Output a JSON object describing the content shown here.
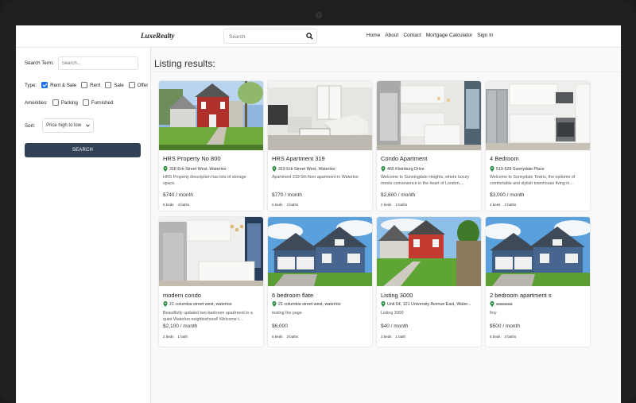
{
  "header": {
    "logo": "LuxeRealty",
    "search_placeholder": "Search",
    "links": [
      "Home",
      "About",
      "Contact",
      "Mortgage Calculator",
      "Sign In"
    ]
  },
  "sidebar": {
    "search_term_label": "Search Term:",
    "search_term_placeholder": "Search...",
    "type_label": "Type:",
    "types": [
      {
        "label": "Rent & Sale",
        "checked": true
      },
      {
        "label": "Rent",
        "checked": false
      },
      {
        "label": "Sale",
        "checked": false
      },
      {
        "label": "Offer",
        "checked": false
      }
    ],
    "amenities_label": "Amenities:",
    "amenities": [
      {
        "label": "Parking",
        "checked": false
      },
      {
        "label": "Furnished",
        "checked": false
      }
    ],
    "sort_label": "Sort:",
    "sort_value": "Price high to low",
    "search_button": "SEARCH"
  },
  "main": {
    "heading": "Listing results:",
    "listings": [
      {
        "title": "HRS Property No 800",
        "address": "318 Erb Street West, Waterloo",
        "description": "HRS Property description has lots of storage space.",
        "price": "$740 / month",
        "beds": "6 beds",
        "baths": "4 baths",
        "image": "red-brick-house"
      },
      {
        "title": "HRS Apartment 319",
        "address": "319 Erb Street West, Waterloo",
        "description": "Apartment 319 5th floor apartment in Waterloo",
        "price": "$770 / month",
        "beds": "5 beds",
        "baths": "2 baths",
        "image": "living-room"
      },
      {
        "title": "Condo Apartment",
        "address": "465 Kleinburg Drive",
        "description": "Welcome to Sunningdale Heights, where luxury meets convenience in the heart of London,...",
        "price": "$2,600 / month",
        "beds": "2 beds",
        "baths": "2 baths",
        "image": "modern-kitchen"
      },
      {
        "title": "4 Bedroom",
        "address": "519-529 Sunnydale Place",
        "description": "Welcome to Sunnydale Towns, the epitome of comfortable and stylish townhouse living in...",
        "price": "$3,000 / month",
        "beds": "4 beds",
        "baths": "2 baths",
        "image": "steel-kitchen"
      },
      {
        "title": "modern condo",
        "address": "21 columbia street west, waterloo",
        "description": "Beautifully updated two-bedroom apartment in a quiet Waterloo neighborhood! Welcome t...",
        "price": "$2,100 / month",
        "beds": "2 beds",
        "baths": "1 bath",
        "image": "condo-kitchen"
      },
      {
        "title": "6 bedroom flate",
        "address": "21 columbia street west, waterloo",
        "description": "testing the page",
        "price": "$6,000",
        "beds": "6 beds",
        "baths": "3 baths",
        "image": "blue-house"
      },
      {
        "title": "Listing 3000",
        "address": "Unit 64, 121 University Avenue East, Water...",
        "description": "Listing 3000",
        "price": "$40 / month",
        "beds": "3 beds",
        "baths": "1 bath",
        "image": "red-siding-house"
      },
      {
        "title": "2 bedroom apartment s",
        "address": "aaaaaaa",
        "description": "fmy",
        "price": "$500 / month",
        "beds": "5 beds",
        "baths": "3 baths",
        "image": "blue-house"
      }
    ]
  },
  "colors": {
    "accent_button": "#324156",
    "pin_green": "#1e8a3a",
    "checkbox_blue": "#1a73e8"
  }
}
